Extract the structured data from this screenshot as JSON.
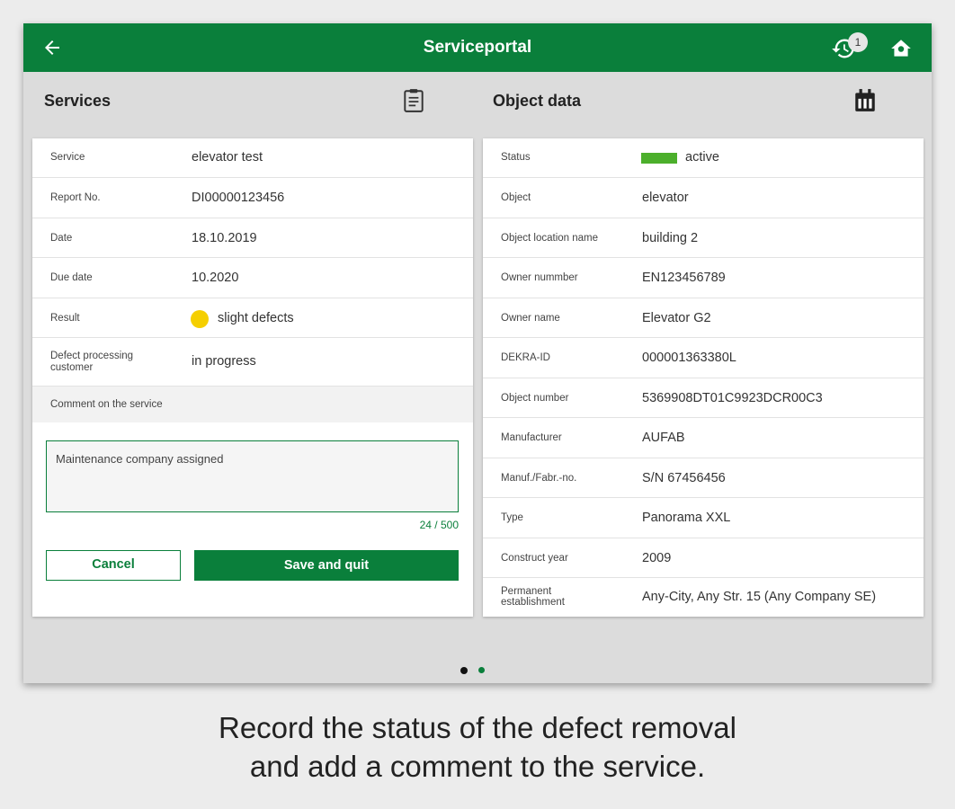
{
  "appbar": {
    "title": "Serviceportal",
    "sync_badge": "1",
    "icons": {
      "back": "arrow-left-icon",
      "sync": "sync-history-icon",
      "home": "home-icon"
    }
  },
  "services": {
    "title": "Services",
    "header_icon": "clipboard-icon",
    "rows": [
      {
        "label": "Service",
        "value": "elevator test"
      },
      {
        "label": "Report No.",
        "value": "DI00000123456"
      },
      {
        "label": "Date",
        "value": "18.10.2019"
      },
      {
        "label": "Due date",
        "value": "10.2020"
      },
      {
        "label": "Result",
        "value": "slight defects"
      },
      {
        "label": "Defect processing customer",
        "value": "in progress"
      }
    ],
    "result_color": "#f5cf00",
    "comment_label": "Comment on the service",
    "comment_value": "Maintenance company assigned",
    "comment_counter": "24 / 500",
    "cancel_label": "Cancel",
    "save_label": "Save and quit"
  },
  "object": {
    "title": "Object data",
    "header_icon": "calendar-icon",
    "status_color": "#4caf2c",
    "rows": [
      {
        "label": "Status",
        "value": "active"
      },
      {
        "label": "Object",
        "value": "elevator"
      },
      {
        "label": "Object location name",
        "value": "building 2"
      },
      {
        "label": "Owner nummber",
        "value": "EN123456789"
      },
      {
        "label": "Owner name",
        "value": "Elevator G2"
      },
      {
        "label": "DEKRA-ID",
        "value": "000001363380L"
      },
      {
        "label": "Object number",
        "value": "5369908DT01C9923DCR00C3"
      },
      {
        "label": "Manufacturer",
        "value": "AUFAB"
      },
      {
        "label": "Manuf./Fabr.-no.",
        "value": "S/N 67456456"
      },
      {
        "label": "Type",
        "value": "Panorama XXL"
      },
      {
        "label": "Construct year",
        "value": "2009"
      },
      {
        "label": "Permanent establishment",
        "value": "Any-City, Any Str. 15 (Any Company SE)"
      }
    ]
  },
  "pager": {
    "pages": 2,
    "active_index": 0
  },
  "caption": {
    "line1": "Record the status of the defect removal",
    "line2": "and add a comment to the service."
  },
  "colors": {
    "brand_green": "#0a7f3b",
    "background": "#dcdcdc"
  }
}
